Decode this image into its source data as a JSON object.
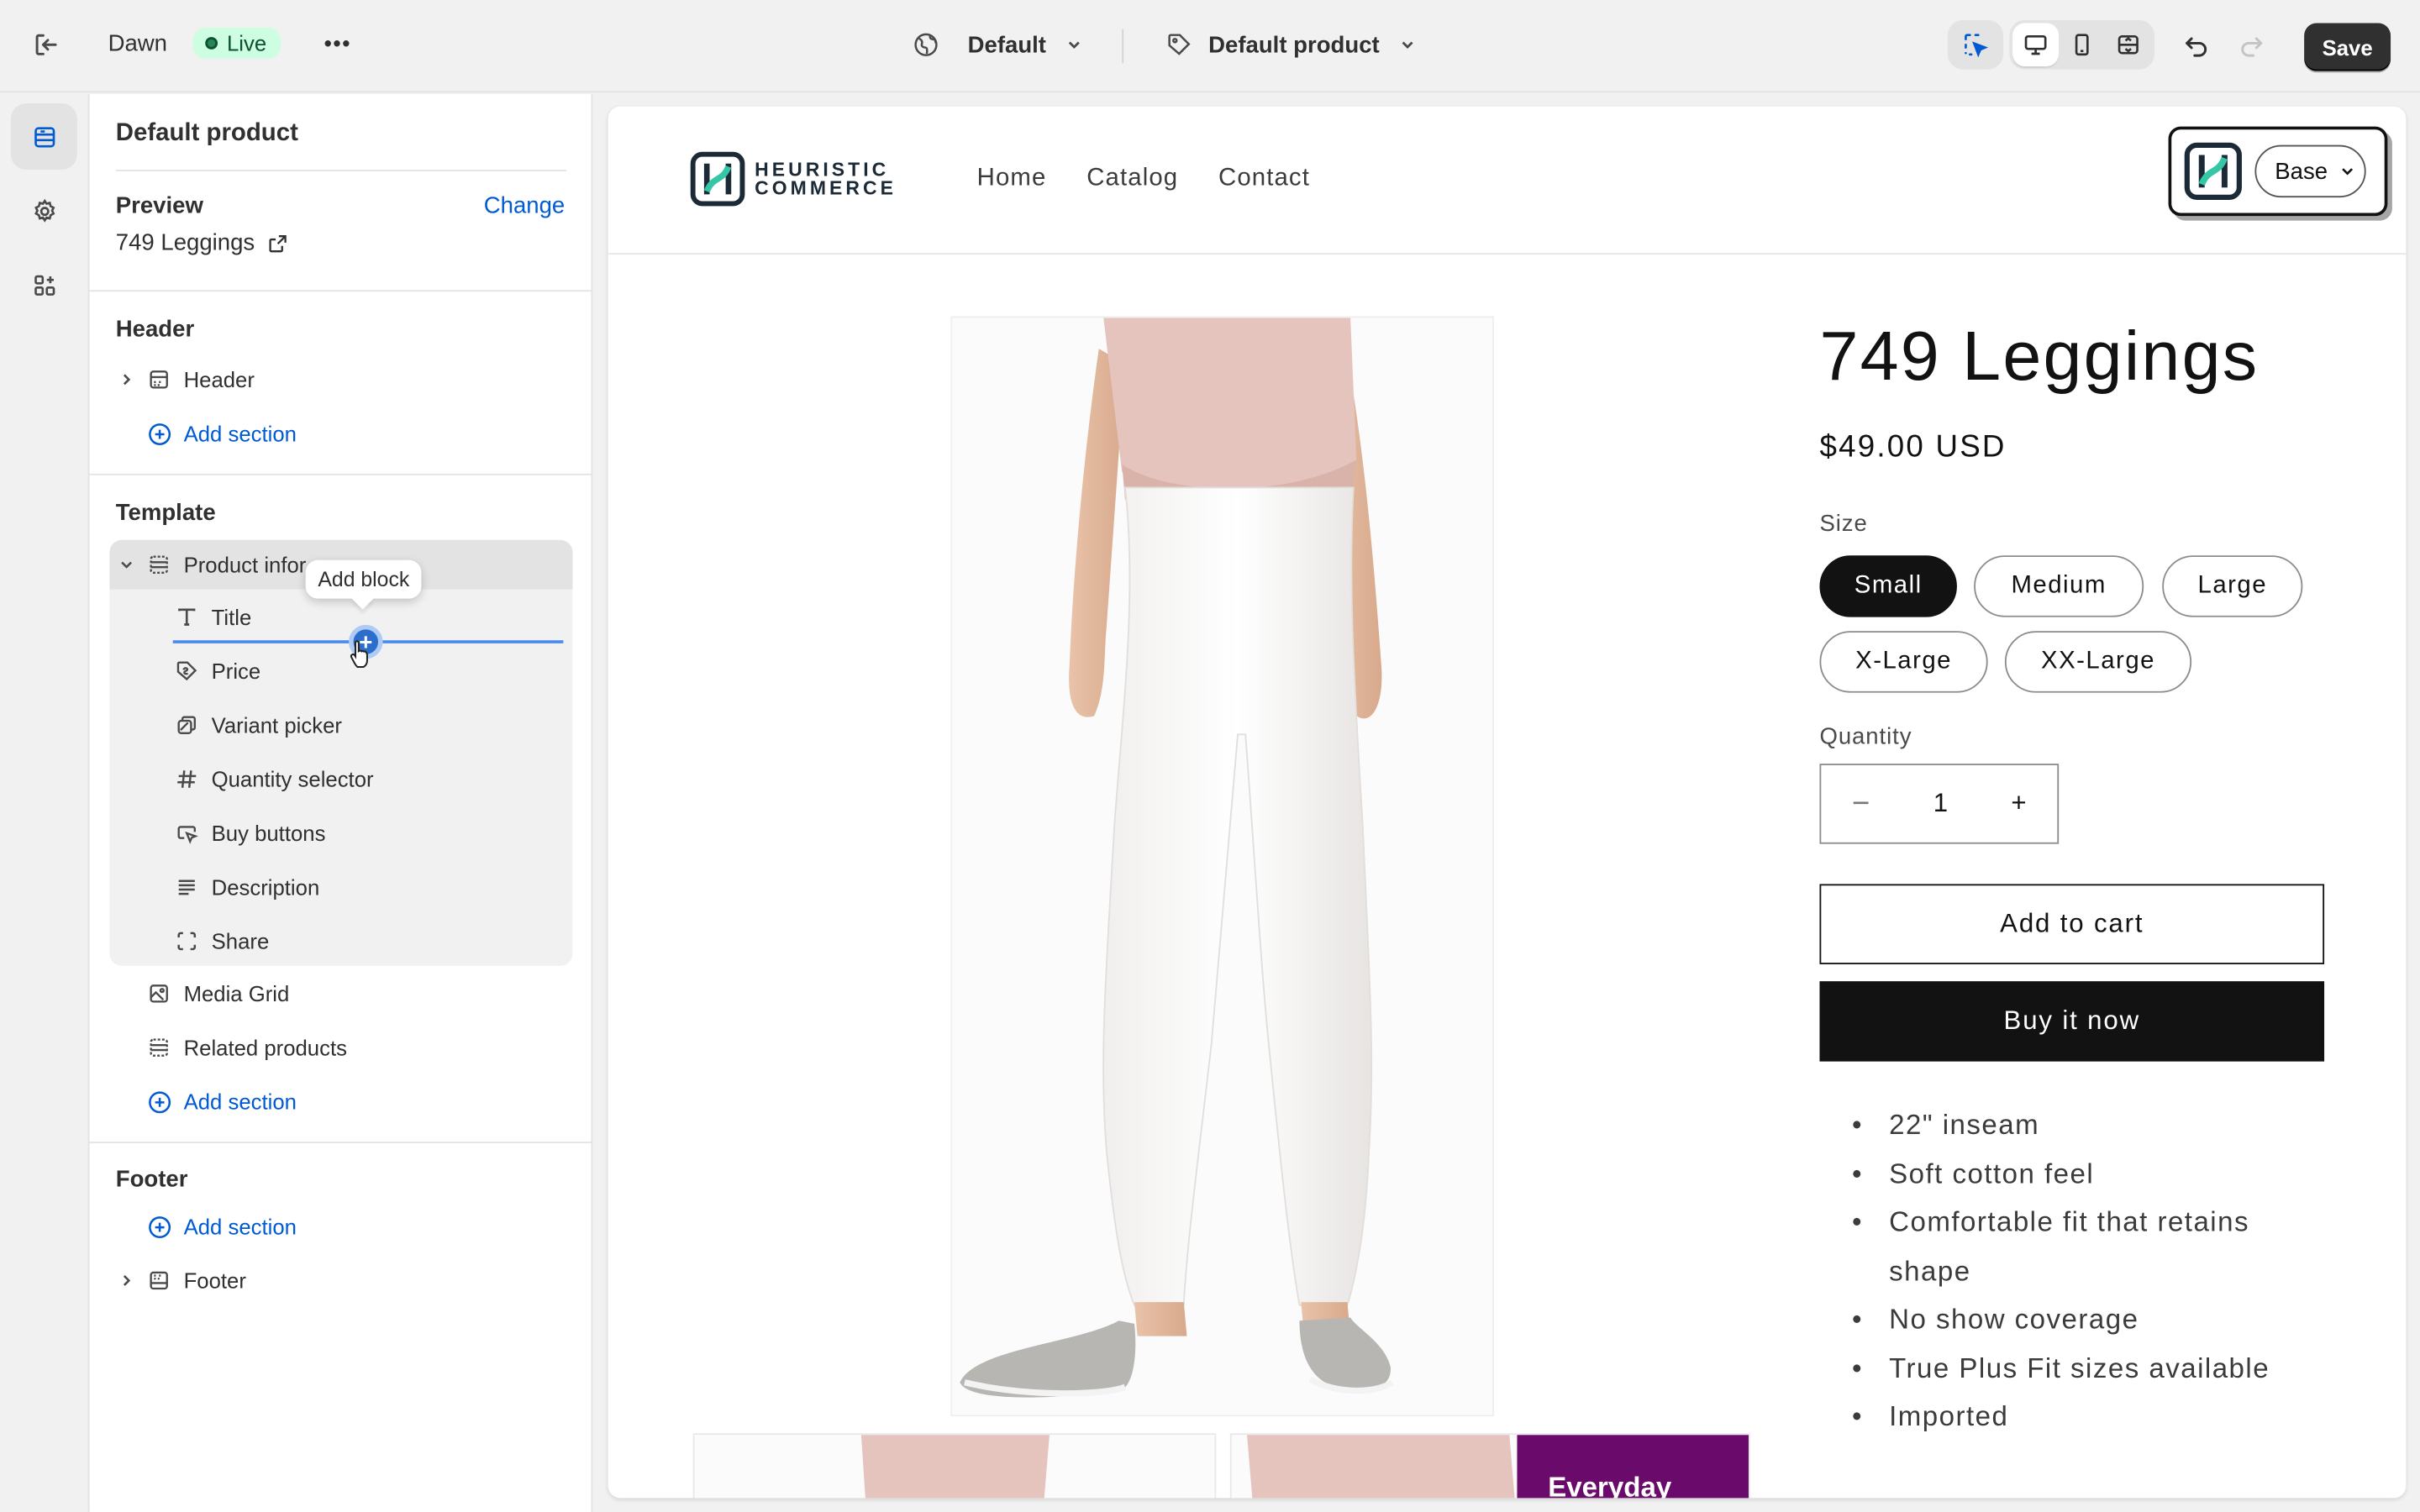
{
  "topbar": {
    "theme_name": "Dawn",
    "status": "Live",
    "more": "•••",
    "view_selector": "Default",
    "template_selector": "Default product",
    "save_label": "Save"
  },
  "sidebar": {
    "title": "Default product",
    "preview_heading": "Preview",
    "change_link": "Change",
    "preview_product": "749 Leggings",
    "header_group": {
      "heading": "Header",
      "items": [
        "Header"
      ],
      "add_section": "Add section"
    },
    "template_group": {
      "heading": "Template",
      "section_name": "Product information",
      "section_name_visible": "Product infor",
      "blocks": [
        "Title",
        "Price",
        "Variant picker",
        "Quantity selector",
        "Buy buttons",
        "Description",
        "Share"
      ],
      "other_sections": [
        "Media Grid",
        "Related products"
      ],
      "add_section": "Add section"
    },
    "footer_group": {
      "heading": "Footer",
      "add_section": "Add section",
      "items": [
        "Footer"
      ]
    },
    "tooltip": "Add block"
  },
  "store": {
    "logo_line1": "HEURISTIC",
    "logo_line2": "COMMERCE",
    "nav": [
      "Home",
      "Catalog",
      "Contact"
    ],
    "picker_value": "Base",
    "product": {
      "title": "749 Leggings",
      "price": "$49.00 USD",
      "size_label": "Size",
      "sizes": [
        "Small",
        "Medium",
        "Large",
        "X-Large",
        "XX-Large"
      ],
      "selected_size": "Small",
      "quantity_label": "Quantity",
      "quantity_value": "1",
      "qty_minus": "−",
      "qty_plus": "+",
      "add_to_cart": "Add to cart",
      "buy_now": "Buy it now",
      "features": [
        "22\" inseam",
        "Soft cotton feel",
        "Comfortable fit that retains shape",
        "No show coverage",
        "True Plus Fit sizes available",
        "Imported"
      ],
      "thumb_badge": "Everyday"
    }
  },
  "colors": {
    "accent": "#005bd3",
    "live_bg": "#cdfee1",
    "badge_purple": "#6a0a6a"
  }
}
